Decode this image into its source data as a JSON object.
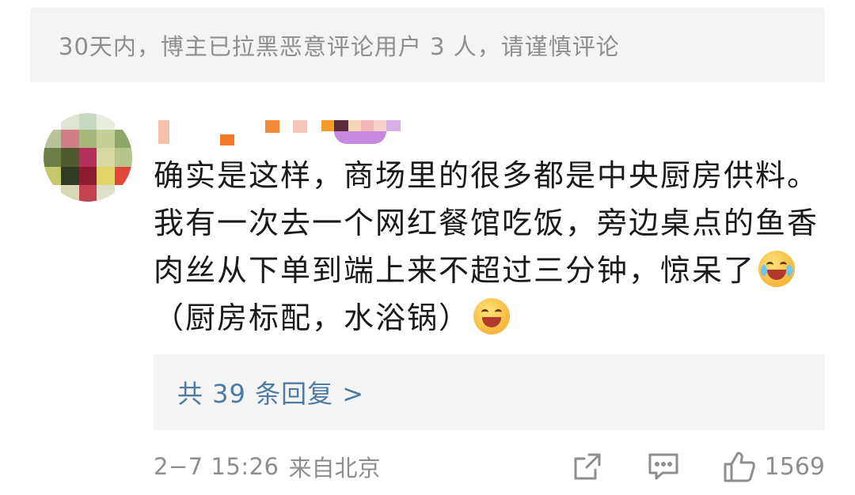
{
  "notice": {
    "text": "30天内，博主已拉黑恶意评论用户 3 人，请谨慎评论"
  },
  "comment": {
    "text_before_emoji": "确实是这样，商场里的很多都是中央厨房供料。我有一次去一个网红餐馆吃饭，旁边桌点的鱼香肉丝从下单到端上来不超过三分钟，惊呆了",
    "text_middle": "（厨房标配，水浴锅）",
    "emoji_1": "laugh-cry-emoji",
    "emoji_2": "laugh-emoji"
  },
  "replies": {
    "label": "共 39 条回复 >"
  },
  "meta": {
    "time": "2−7 15:26",
    "source": "来自北京",
    "like_count": "1569",
    "icons": [
      "share-icon",
      "comment-icon",
      "like-icon"
    ]
  },
  "colors": {
    "link_blue": "#4e7ba6",
    "gray_text": "#8e8e8e",
    "panel_bg": "#f4f4f4"
  }
}
